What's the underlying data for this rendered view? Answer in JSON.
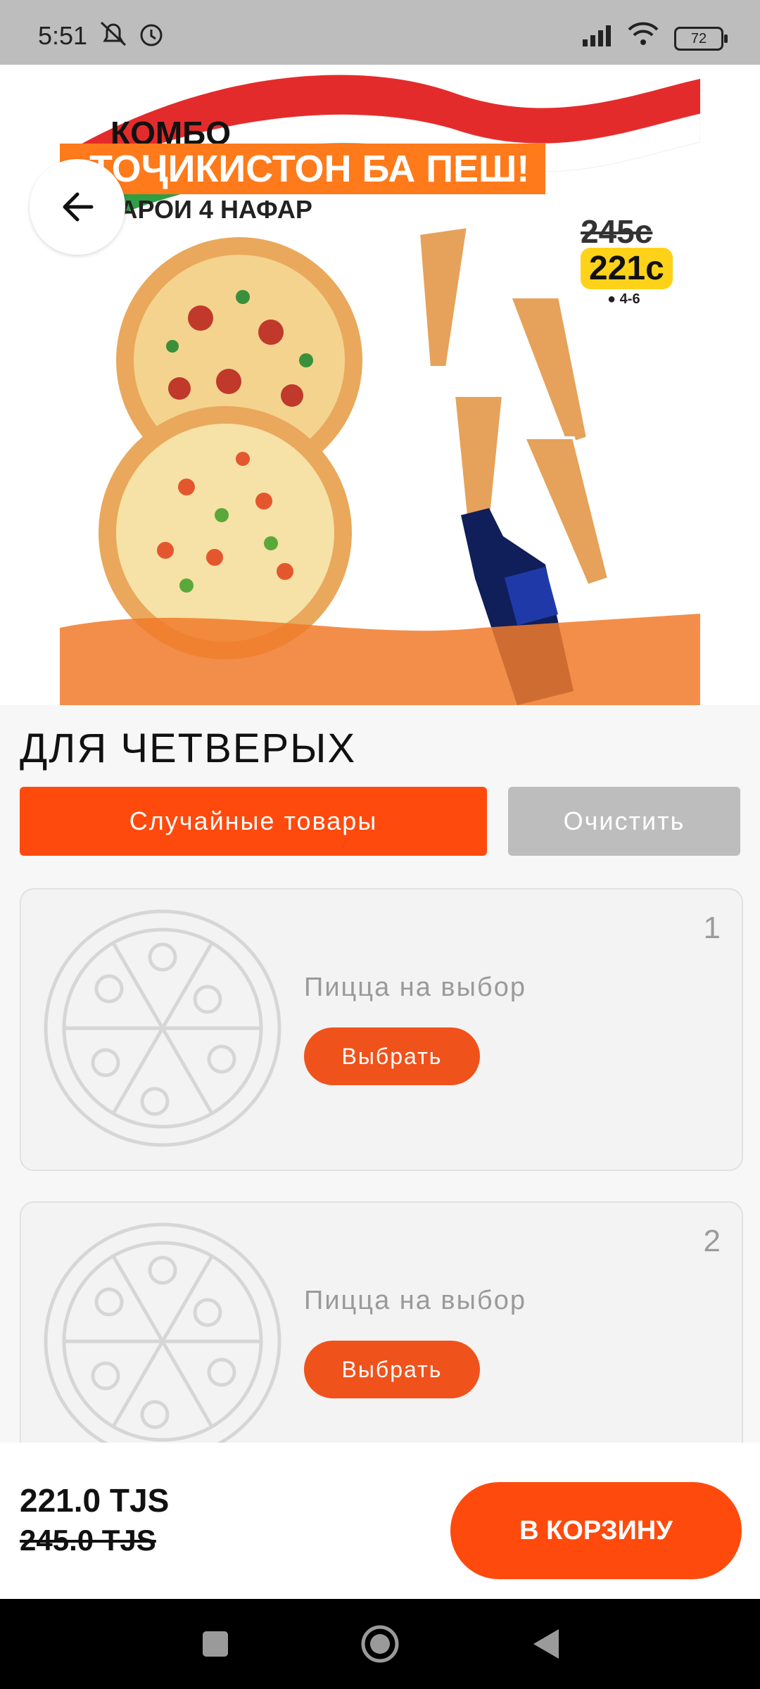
{
  "status_bar": {
    "time": "5:51",
    "battery": "72"
  },
  "hero": {
    "poster_title": "КОМБО",
    "poster_banner": "ТОҶИКИСТОН БА ПЕШ!",
    "poster_subtitle": "БАРОИ 4 НАФАР",
    "poster_price_old": "245с",
    "poster_price_new": "221с",
    "poster_people": "4-6"
  },
  "page": {
    "title": "ДЛЯ ЧЕТВЕРЫХ",
    "random_button": "Случайные товары",
    "clear_button": "Очистить"
  },
  "slots": [
    {
      "number": "1",
      "label": "Пицца на выбор",
      "button": "Выбрать"
    },
    {
      "number": "2",
      "label": "Пицца на выбор",
      "button": "Выбрать"
    }
  ],
  "bottom": {
    "price_new": "221.0 TJS",
    "price_old": "245.0 TJS",
    "cart_button": "В КОРЗИНУ"
  },
  "colors": {
    "accent": "#ff4a0d",
    "gray_button": "#bdbdbd"
  }
}
